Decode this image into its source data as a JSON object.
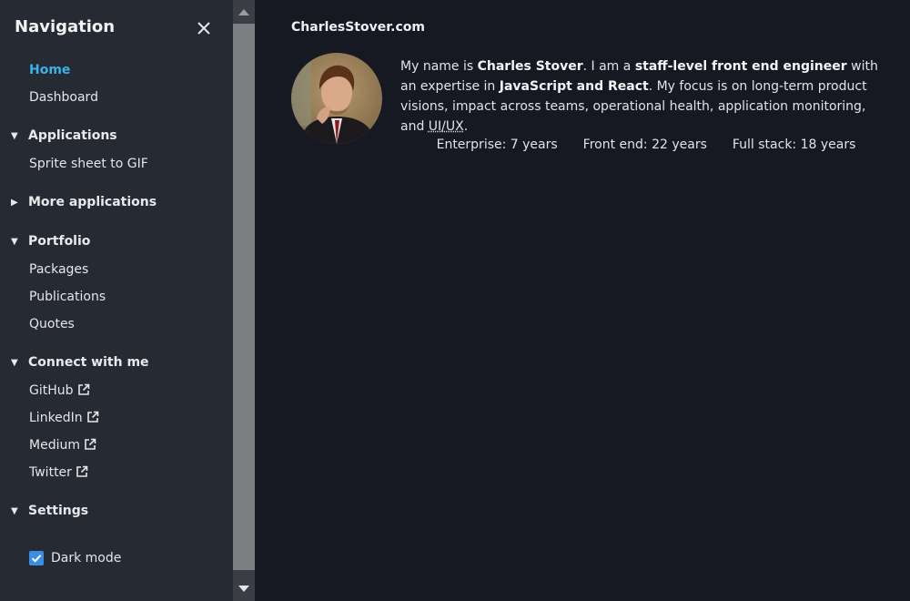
{
  "sidebar": {
    "title": "Navigation",
    "items": {
      "home": "Home",
      "dashboard": "Dashboard"
    },
    "applications": {
      "label": "Applications",
      "items": [
        "Sprite sheet to GIF"
      ]
    },
    "more_applications": {
      "label": "More applications"
    },
    "portfolio": {
      "label": "Portfolio",
      "items": [
        "Packages",
        "Publications",
        "Quotes"
      ]
    },
    "connect": {
      "label": "Connect with me",
      "items": [
        "GitHub",
        "LinkedIn",
        "Medium",
        "Twitter"
      ]
    },
    "settings": {
      "label": "Settings",
      "dark_mode": {
        "label": "Dark mode",
        "checked": true
      }
    }
  },
  "main": {
    "site_title": "CharlesStover.com",
    "bio": {
      "p1": "My name is ",
      "name": "Charles Stover",
      "p2": ". I am a ",
      "role": "staff-level front end engineer",
      "p3": " with an expertise in ",
      "tech": "JavaScript and React",
      "p4": ". My focus is on long-term product visions, impact across teams, operational health, application monitoring, and ",
      "uiux": "UI/UX",
      "p5": "."
    },
    "stats": [
      "Enterprise: 7 years",
      "Front end: 22 years",
      "Full stack: 18 years"
    ]
  },
  "colors": {
    "sidebar_bg": "#262a33",
    "main_bg": "#161922",
    "accent": "#39b3e6",
    "checkbox": "#3a8ee6"
  },
  "icons": {
    "close": "close-icon",
    "expanded": "caret-down-icon",
    "collapsed": "caret-right-icon",
    "external": "external-link-icon",
    "check": "check-icon"
  }
}
